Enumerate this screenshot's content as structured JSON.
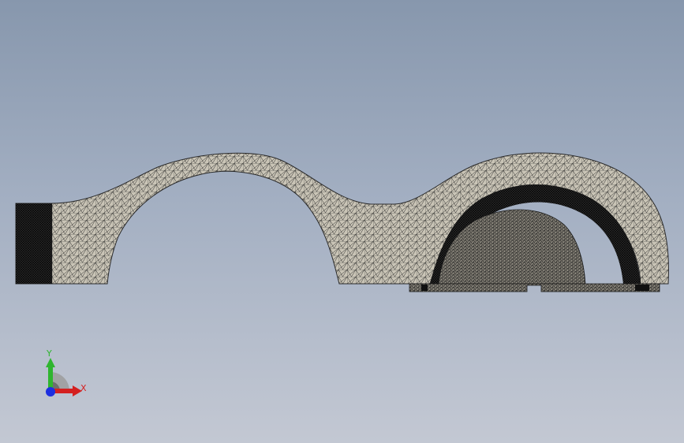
{
  "viewport": {
    "background_top": "#8797ad",
    "background_bottom": "#c3c8d3",
    "model_fill": "#c9c4b6",
    "mesh_color": "#2a2a2a"
  },
  "triad": {
    "x_label": "X",
    "y_label": "Y",
    "x_color": "#d42020",
    "y_color": "#2fb52f",
    "z_color": "#1d2fe0"
  }
}
